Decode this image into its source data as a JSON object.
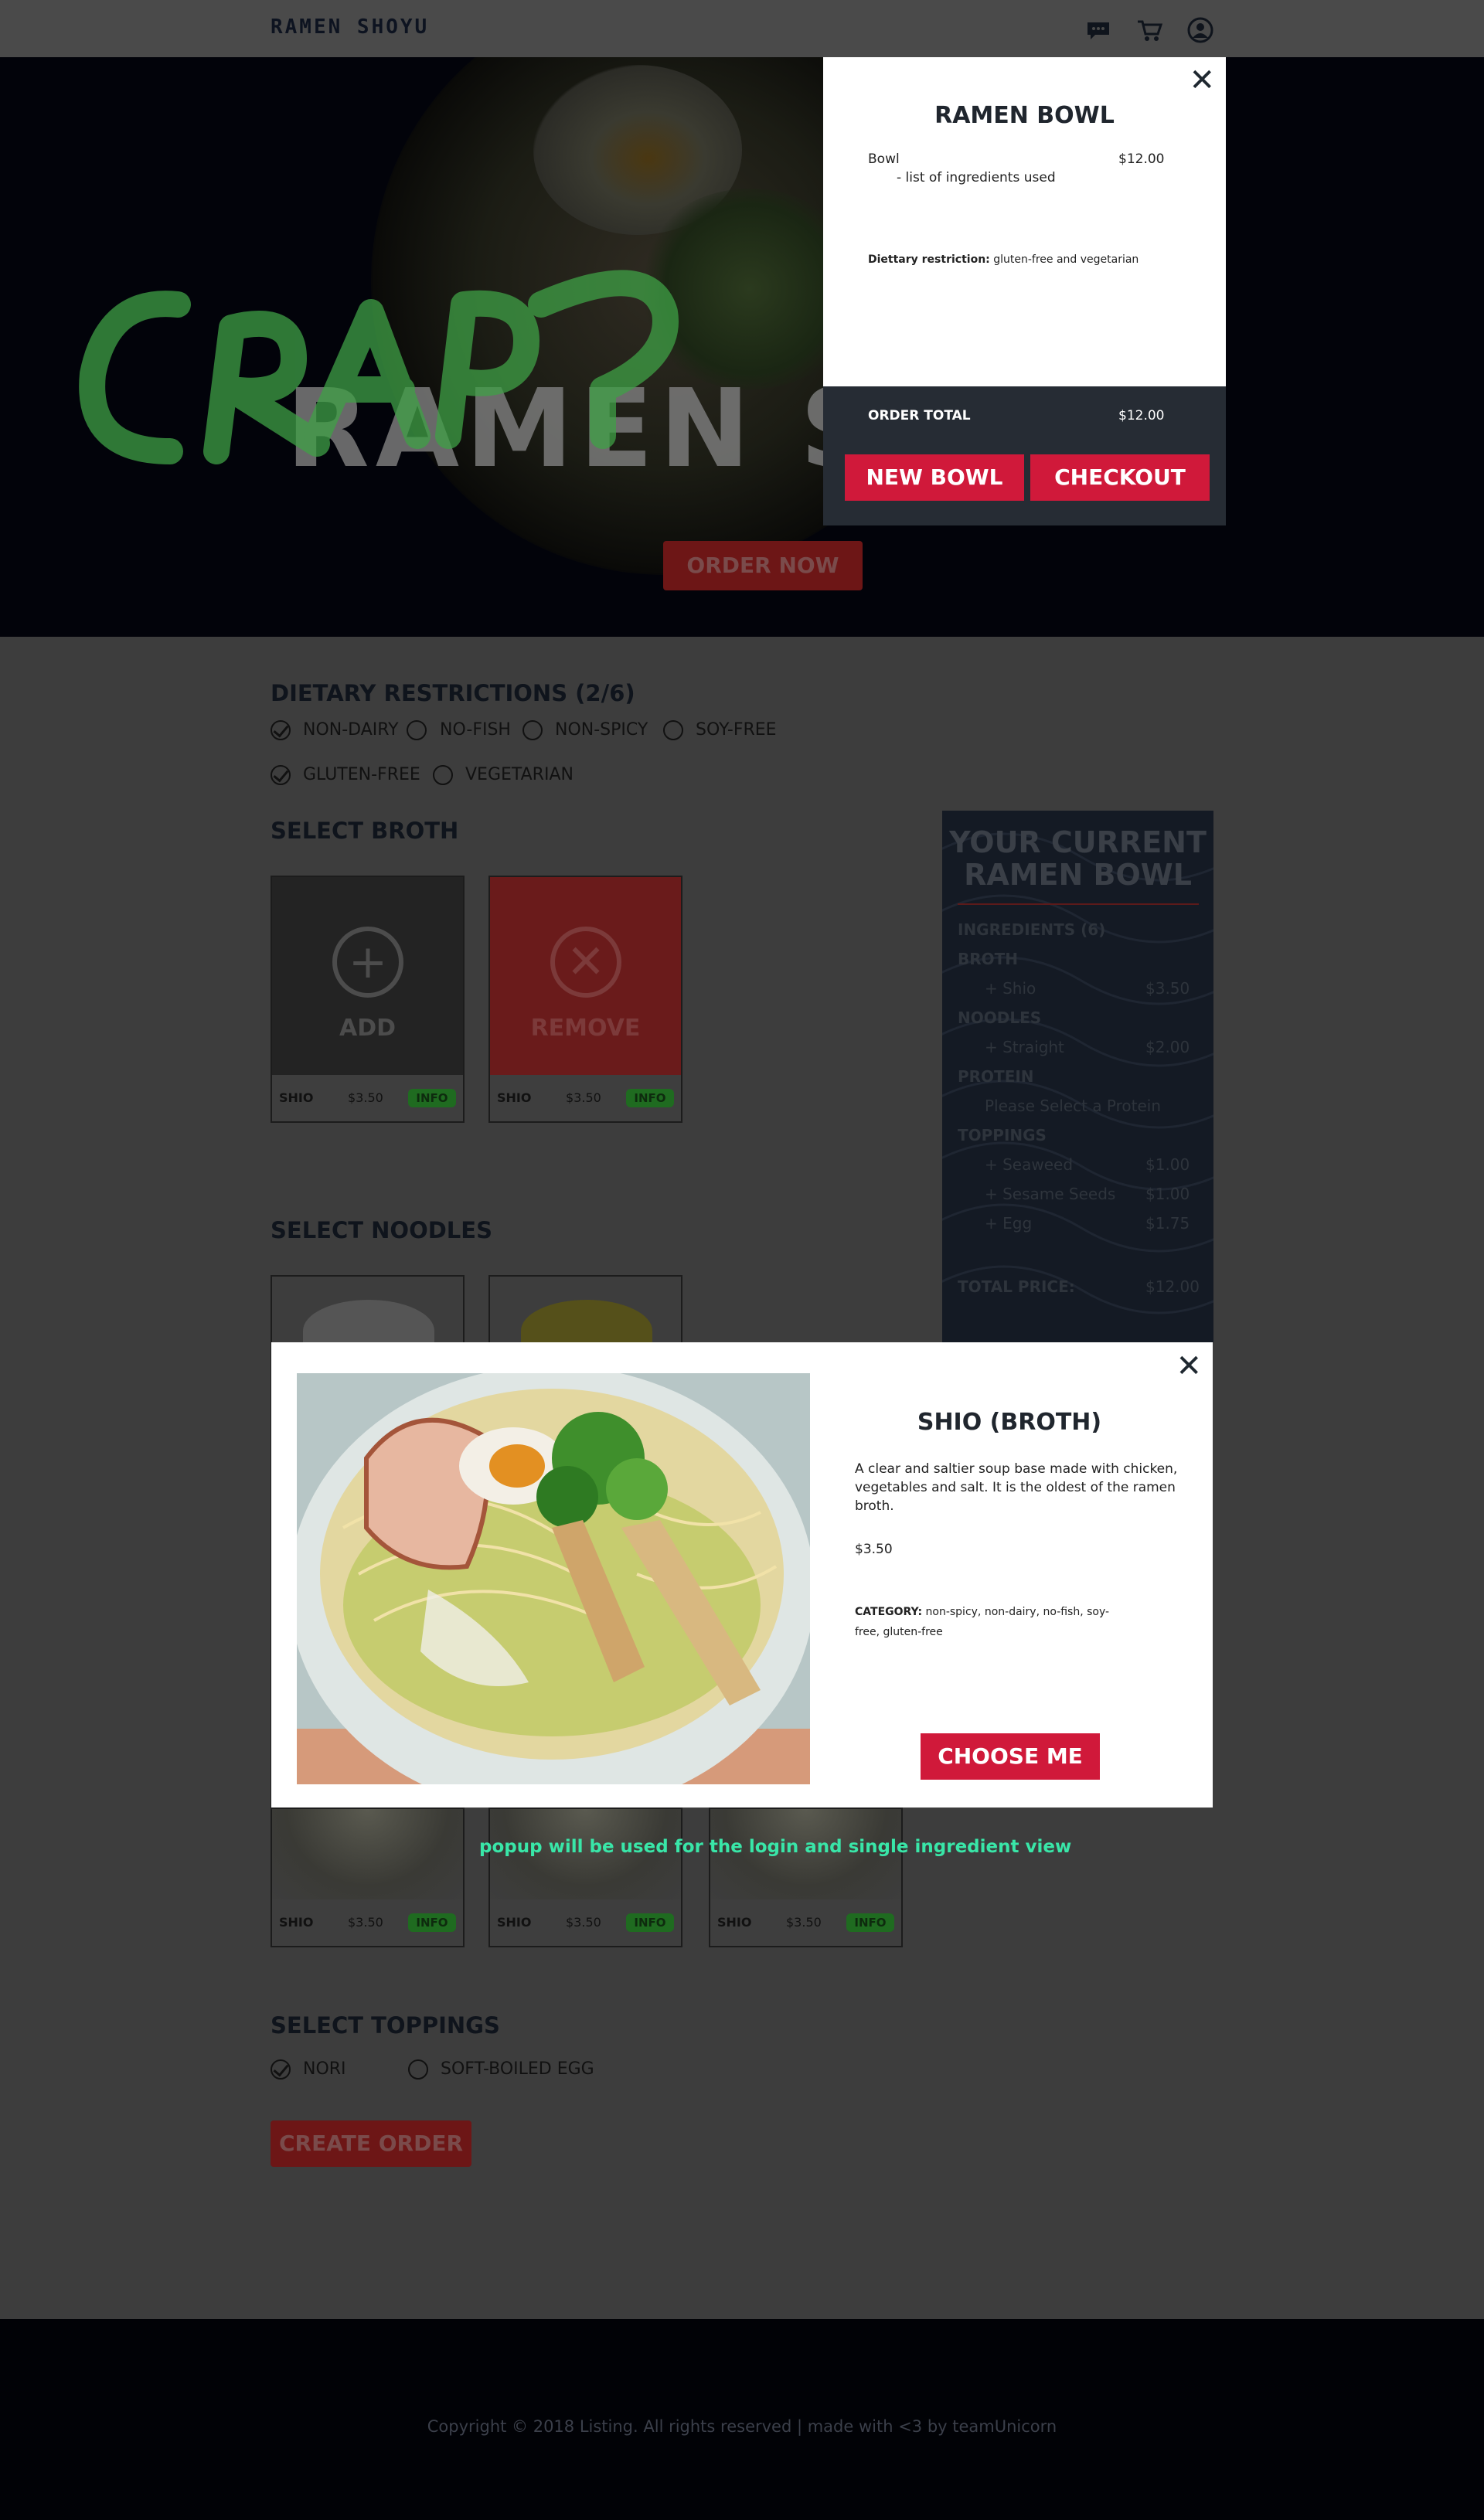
{
  "header": {
    "logo": "RAMEN SHOYU",
    "icons": [
      "chat-icon",
      "cart-icon",
      "user-icon"
    ]
  },
  "hero": {
    "title": "RAMEN S",
    "scribble": "CRAP?",
    "order_now": "ORDER NOW"
  },
  "cart": {
    "title": "RAMEN BOWL",
    "item_label": "Bowl",
    "item_price": "$12.00",
    "ingredients_note": "- list of ingredients used",
    "diet_label": "Diettary restriction:",
    "diet_value": "gluten-free and vegetarian",
    "total_label": "ORDER TOTAL",
    "total_value": "$12.00",
    "new_bowl": "NEW BOWL",
    "checkout": "CHECKOUT"
  },
  "dietary": {
    "heading": "DIETARY RESTRICTIONS (2/6)",
    "options": [
      {
        "label": "NON-DAIRY",
        "checked": true
      },
      {
        "label": "NO-FISH",
        "checked": false
      },
      {
        "label": "NON-SPICY",
        "checked": false
      },
      {
        "label": "SOY-FREE",
        "checked": false
      },
      {
        "label": "GLUTEN-FREE",
        "checked": true
      },
      {
        "label": "VEGETARIAN",
        "checked": false
      }
    ]
  },
  "broth": {
    "heading": "SELECT BROTH",
    "add_label": "ADD",
    "remove_label": "REMOVE",
    "cards": [
      {
        "name": "SHIO",
        "price": "$3.50",
        "info": "INFO"
      },
      {
        "name": "SHIO",
        "price": "$3.50",
        "info": "INFO"
      }
    ]
  },
  "noodles": {
    "heading": "SELECT NOODLES",
    "cards": [
      {
        "name": "SHIO",
        "price": "$3.50",
        "info": "INFO"
      },
      {
        "name": "SHIO",
        "price": "$3.50",
        "info": "INFO"
      },
      {
        "name": "SHIO",
        "price": "$3.50",
        "info": "INFO"
      }
    ]
  },
  "summary": {
    "title": "YOUR CURRENT RAMEN BOWL",
    "ingredients": "INGREDIENTS (6)",
    "broth": "BROTH",
    "broth_item": "+ Shio",
    "broth_price": "$3.50",
    "noodles": "NOODLES",
    "noodles_item": "+ Straight",
    "noodles_price": "$2.00",
    "protein": "PROTEIN",
    "protein_item": "Please Select a Protein",
    "toppings": "TOPPINGS",
    "top1": "+ Seaweed",
    "top1_price": "$1.00",
    "top2": "+ Sesame Seeds",
    "top2_price": "$1.00",
    "top3": "+ Egg",
    "top3_price": "$1.75",
    "total_label": "TOTAL PRICE:",
    "total_value": "$12.00"
  },
  "popup": {
    "title": "SHIO (BROTH)",
    "description": "A clear and saltier soup base made with chicken, vegetables and salt. It is the oldest of the ramen broth.",
    "price": "$3.50",
    "category_label": "CATEGORY:",
    "category_value": "non-spicy, non-dairy, no-fish, soy-free, gluten-free",
    "choose": "CHOOSE ME"
  },
  "annotation": "popup will be used for the login and single ingredient view",
  "toppings": {
    "heading": "SELECT TOPPINGS",
    "options": [
      {
        "label": "NORI",
        "checked": true
      },
      {
        "label": "SOFT-BOILED EGG",
        "checked": false
      }
    ]
  },
  "create_order": "CREATE ORDER",
  "footer": {
    "copyright": "Copyright  © 2018 Listing. All rights reserved | made with <3 by teamUnicorn"
  },
  "colors": {
    "accent_red": "#d0193a",
    "dark_navy": "#262c34",
    "info_green": "#1f6b20",
    "note_green": "#39e6a8"
  }
}
